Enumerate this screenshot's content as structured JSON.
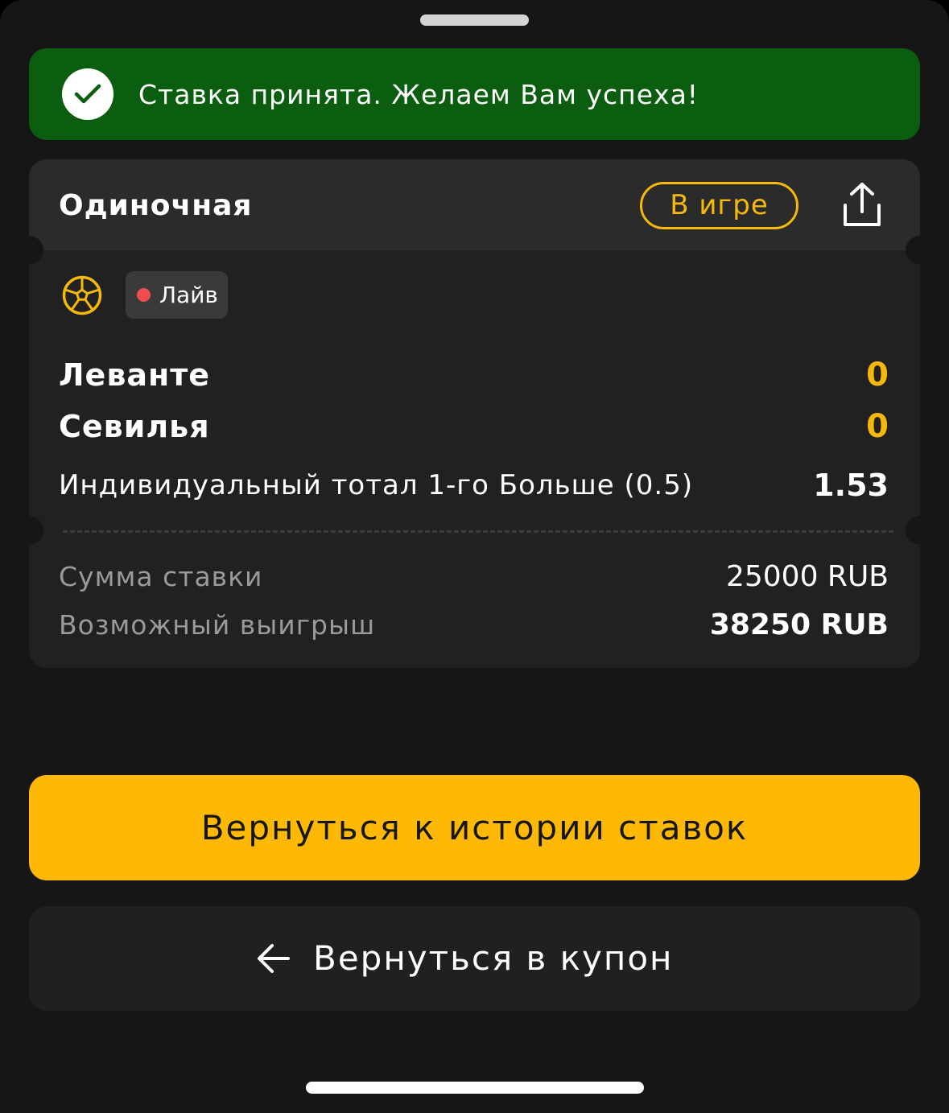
{
  "toast": {
    "message": "Ставка принята. Желаем Вам успеха!",
    "icon": "check-icon",
    "color": "#0b5e0f"
  },
  "bet": {
    "type": "Одиночная",
    "status": "В игре",
    "status_color": "#f6b80b",
    "share_icon": "share-icon",
    "sport_icon": "soccer-ball-icon",
    "live_label": "Лайв",
    "teams": [
      {
        "name": "Леванте",
        "score": "0"
      },
      {
        "name": "Севилья",
        "score": "0"
      }
    ],
    "market": "Индивидуальный тотал 1-го Больше (0.5)",
    "odds": "1.53",
    "stake_label": "Сумма ставки",
    "stake_value": "25000 RUB",
    "win_label": "Возможный выигрыш",
    "win_value": "38250 RUB"
  },
  "actions": {
    "history_label": "Вернуться к истории ставок",
    "history_color": "#fdb905",
    "coupon_label": "Вернуться в купон",
    "coupon_icon": "arrow-left-icon"
  }
}
